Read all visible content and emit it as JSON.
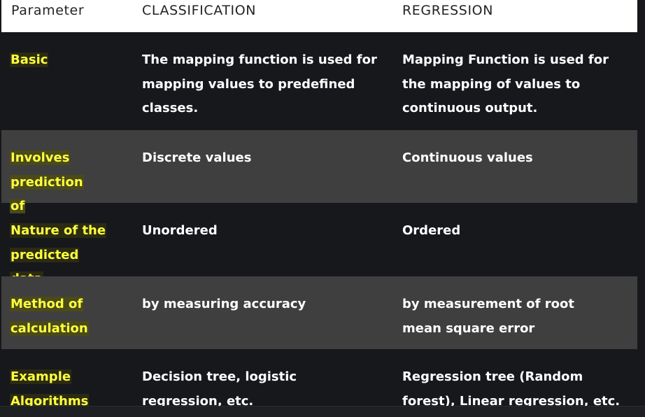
{
  "table": {
    "headers": [
      "Parameter",
      "CLASSIFICATION",
      "REGRESSION"
    ],
    "rows": [
      {
        "parameter": "Basic",
        "classification": "The mapping function is used for mapping values to predefined classes.",
        "regression": "Mapping Function is used for the mapping of values to continuous output."
      },
      {
        "parameter": "Involves prediction of",
        "classification": "Discrete values",
        "regression": "Continuous values"
      },
      {
        "parameter": "Nature of the predicted data",
        "classification": "Unordered",
        "regression": "Ordered"
      },
      {
        "parameter": "Method of calculation",
        "classification": "by measuring accuracy",
        "regression": "by measurement of root mean square error"
      },
      {
        "parameter": "Example Algorithms",
        "classification": "Decision tree, logistic regression, etc.",
        "regression": "Regression tree (Random forest), Linear regression, etc."
      }
    ]
  }
}
